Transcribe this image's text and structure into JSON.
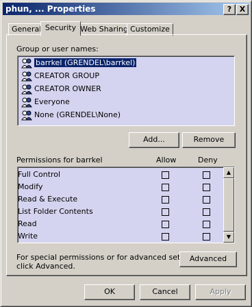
{
  "window": {
    "title": "phun, ... Properties"
  },
  "titlebar_buttons": {
    "help": "?",
    "close": "X"
  },
  "tabs": [
    {
      "label": "General"
    },
    {
      "label": "Security"
    },
    {
      "label": "Web Sharing"
    },
    {
      "label": "Customize"
    }
  ],
  "group_section": {
    "label": "Group or user names:"
  },
  "users": [
    {
      "name": "barrkel (GRENDEL\\barrkel)",
      "selected": true
    },
    {
      "name": "CREATOR GROUP",
      "selected": false
    },
    {
      "name": "CREATOR OWNER",
      "selected": false
    },
    {
      "name": "Everyone",
      "selected": false
    },
    {
      "name": "None (GRENDEL\\None)",
      "selected": false
    }
  ],
  "buttons": {
    "add": "Add...",
    "remove": "Remove",
    "advanced": "Advanced",
    "ok": "OK",
    "cancel": "Cancel",
    "apply": "Apply"
  },
  "permissions": {
    "label": "Permissions for barrkel",
    "allow_header": "Allow",
    "deny_header": "Deny",
    "rows": [
      {
        "name": "Full Control",
        "allow": false,
        "deny": false
      },
      {
        "name": "Modify",
        "allow": false,
        "deny": false
      },
      {
        "name": "Read & Execute",
        "allow": false,
        "deny": false
      },
      {
        "name": "List Folder Contents",
        "allow": false,
        "deny": false
      },
      {
        "name": "Read",
        "allow": false,
        "deny": false
      },
      {
        "name": "Write",
        "allow": false,
        "deny": false
      }
    ]
  },
  "advanced_note": {
    "line1": "For special permissions or for advanced settings,",
    "line2": "click Advanced."
  },
  "icons": {
    "user_icon": "users-group-icon",
    "scroll_up": "scroll-up-arrow-icon",
    "scroll_down": "scroll-down-arrow-icon"
  }
}
